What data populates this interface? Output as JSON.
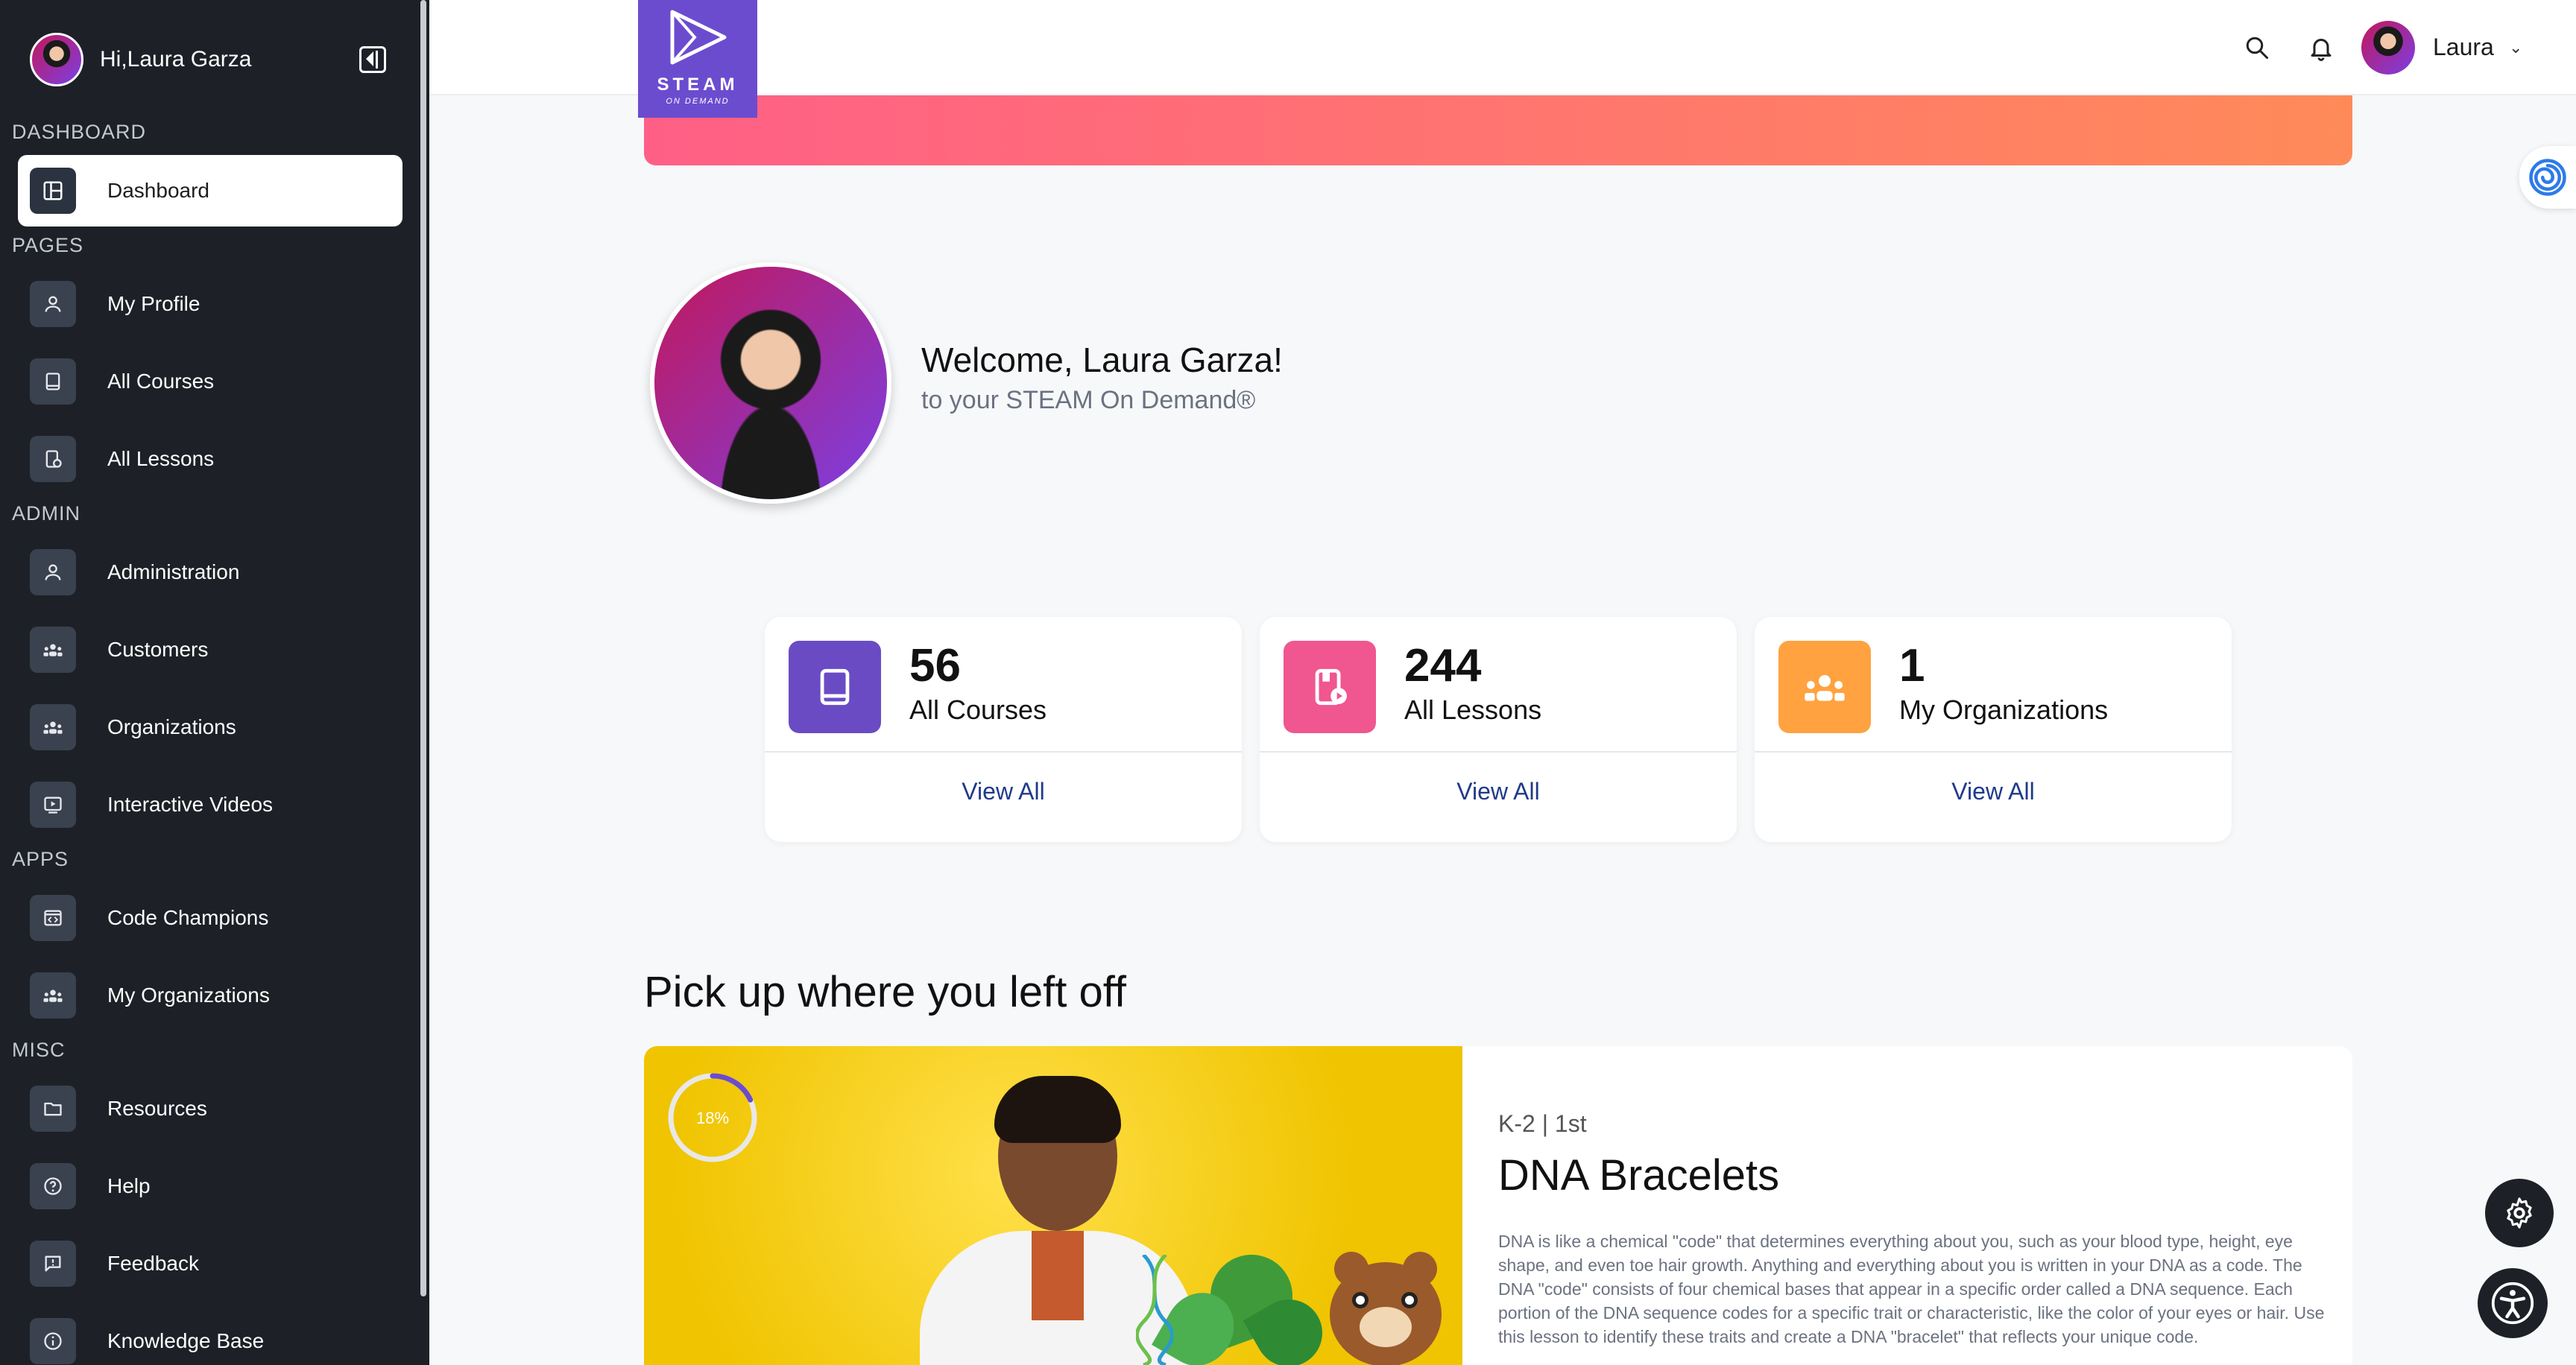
{
  "sidebar": {
    "greeting": "Hi,Laura Garza",
    "sections": {
      "dashboard": "DASHBOARD",
      "pages": "PAGES",
      "admin": "ADMIN",
      "apps": "APPS",
      "misc": "MISC"
    },
    "items": {
      "dashboard": {
        "label": "Dashboard",
        "icon": "dashboard-icon"
      },
      "my_profile": {
        "label": "My Profile",
        "icon": "user-icon"
      },
      "all_courses": {
        "label": "All Courses",
        "icon": "book-icon"
      },
      "all_lessons": {
        "label": "All Lessons",
        "icon": "lesson-icon"
      },
      "administration": {
        "label": "Administration",
        "icon": "user-icon"
      },
      "customers": {
        "label": "Customers",
        "icon": "group-icon"
      },
      "organizations": {
        "label": "Organizations",
        "icon": "group-icon"
      },
      "interactive_videos": {
        "label": "Interactive Videos",
        "icon": "video-icon"
      },
      "code_champions": {
        "label": "Code Champions",
        "icon": "code-icon"
      },
      "my_organizations": {
        "label": "My Organizations",
        "icon": "group-icon"
      },
      "resources": {
        "label": "Resources",
        "icon": "folder-icon"
      },
      "help": {
        "label": "Help",
        "icon": "help-icon"
      },
      "feedback": {
        "label": "Feedback",
        "icon": "feedback-icon"
      },
      "knowledge_base": {
        "label": "Knowledge Base",
        "icon": "info-icon"
      }
    }
  },
  "header": {
    "logo_text": "STEAM",
    "logo_subtext": "ON DEMAND",
    "user_name": "Laura"
  },
  "welcome": {
    "title": "Welcome, Laura Garza!",
    "subtitle": "to your STEAM On Demand®"
  },
  "stats": [
    {
      "value": "56",
      "label": "All Courses",
      "link": "View All",
      "color": "#6a4bc4"
    },
    {
      "value": "244",
      "label": "All Lessons",
      "link": "View All",
      "color": "#f0568f"
    },
    {
      "value": "1",
      "label": "My Organizations",
      "link": "View All",
      "color": "#ffa23f"
    }
  ],
  "continue": {
    "heading": "Pick up where you left off",
    "progress_label": "18%",
    "progress": 0.18,
    "grade": "K-2 | 1st",
    "title": "DNA Bracelets",
    "description": "DNA is like a chemical \"code\" that determines everything about you, such as your blood type, height, eye shape, and even toe hair growth. Anything and everything about you is written in your DNA as a code. The DNA \"code\" consists of four chemical bases that appear in a specific order called a DNA sequence. Each portion of the DNA sequence codes for a specific trait or characteristic, like the color of your eyes or hair. Use this lesson to identify these traits and create a DNA \"bracelet\" that reflects your unique code."
  },
  "colors": {
    "sidebar_bg": "#1d2127",
    "brand_purple": "#6b4ccf",
    "banner_start": "#ff5f86",
    "banner_end": "#ff8a59",
    "link": "#1f3a8a"
  }
}
